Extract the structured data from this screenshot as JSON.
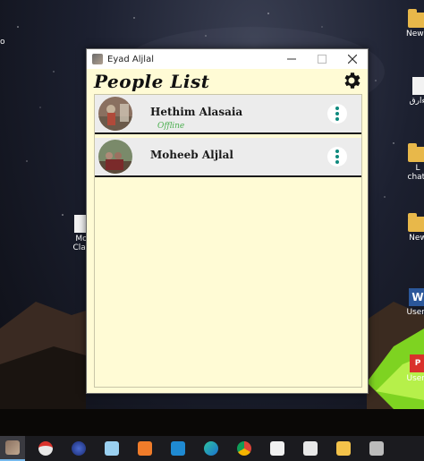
{
  "window": {
    "title": "Eyad Aljlal",
    "minimize_icon": "minimize-icon",
    "maximize_icon": "maximize-icon",
    "close_icon": "close-icon"
  },
  "app": {
    "heading": "People List",
    "settings_icon": "gear-icon"
  },
  "people": [
    {
      "name": "Hethim Alasaia",
      "status": "Offline"
    },
    {
      "name": "Moheeb Aljlal",
      "status": ""
    }
  ],
  "desktop": {
    "edge_labels": [
      "o",
      "NewC",
      "ةءارق",
      "L",
      "chat-",
      "Mo",
      "Clas",
      "New",
      "User_",
      "User_"
    ]
  },
  "colors": {
    "app_background": "#fffbd5",
    "row_background": "#ececec",
    "status_offline": "#4caf50",
    "menu_dots": "#0f8a7e"
  },
  "taskbar": {
    "items": [
      "photo-icon",
      "tray-icon",
      "browser-icon",
      "notepad-icon",
      "xampp-icon",
      "vscode-icon",
      "edge-icon",
      "chrome-icon",
      "mail-icon",
      "store-icon",
      "explorer-icon",
      "snip-icon"
    ]
  }
}
